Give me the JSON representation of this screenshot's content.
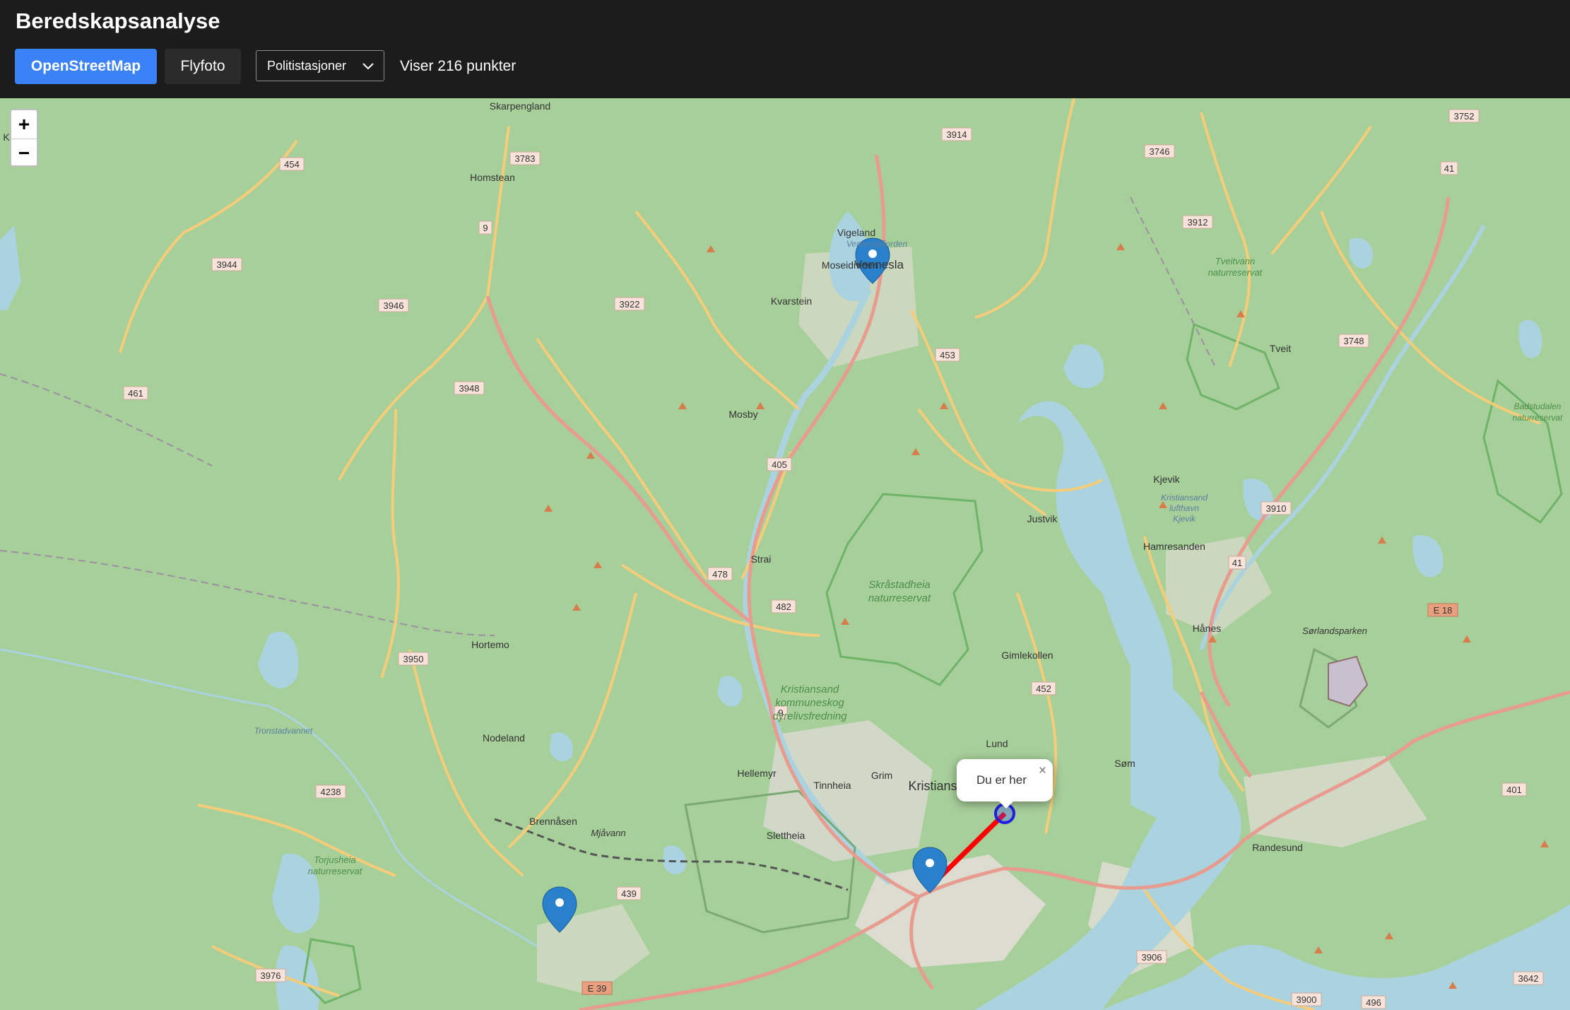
{
  "header": {
    "title": "Beredskapsanalyse",
    "btn_osm": "OpenStreetMap",
    "btn_flyfoto": "Flyfoto",
    "select_value": "Politistasjoner",
    "count_text": "Viser 216 punkter"
  },
  "zoom": {
    "in": "+",
    "out": "−"
  },
  "popup": {
    "text": "Du er her",
    "close": "×"
  },
  "colors": {
    "accent": "#3b82f6",
    "header_bg": "#1c1c1c",
    "map_land": "#aad3a0",
    "water": "#aad3df",
    "road_major": "#e89b8f",
    "road_secondary": "#f5cd7a",
    "route_line": "#ff0000",
    "marker": "#2a81cb"
  },
  "map": {
    "places": {
      "vennesla": "Vennesla",
      "moseidmoen": "Moseidmoen",
      "vigeland": "Vigeland",
      "kvarstein": "Kvarstein",
      "mosby": "Mosby",
      "strai": "Strai",
      "justvik": "Justvik",
      "kjevik": "Kjevik",
      "hamresanden": "Hamresanden",
      "tveit": "Tveit",
      "hanes": "Hånes",
      "sorlandsparken": "Sørlandsparken",
      "gimlekollen": "Gimlekollen",
      "lund": "Lund",
      "kristiansand": "Kristiansand",
      "som": "Søm",
      "randesund": "Randesund",
      "hellemyr": "Hellemyr",
      "tinnheia": "Tinnheia",
      "grim": "Grim",
      "slettheia": "Slettheia",
      "mjovann": "Mjåvann",
      "brennasen": "Brennåsen",
      "nodeland": "Nodeland",
      "hortemo": "Hortemo",
      "homstean": "Homstean",
      "kilen": "Kilen",
      "skarpengland": "Skarpengland",
      "venneslafjorden": "Venneslafjorden",
      "tronstadvannet": "Tronstadvannet"
    },
    "reserves": {
      "skrastadheia_1": "Skråstadheia",
      "skrastadheia_2": "naturreservat",
      "tveitvann_1": "Tveitvann",
      "tveitvann_2": "naturreservat",
      "badstudalen_1": "Badstudalen",
      "badstudalen_2": "naturreservat",
      "torjusheia_1": "Torjusheia",
      "torjusheia_2": "naturreservat",
      "dyrelivs_1": "Kristiansand",
      "dyrelivs_2": "kommuneskog",
      "dyrelivs_3": "dyrelivsfredning",
      "kjevik_1": "Kristiansand",
      "kjevik_2": "lufthavn",
      "kjevik_3": "Kjevik"
    },
    "road_shields": {
      "r454": "454",
      "r3783": "3783",
      "r9a": "9",
      "r3944": "3944",
      "r3946": "3946",
      "r3922": "3922",
      "r461": "461",
      "r3948": "3948",
      "r3914": "3914",
      "r3746": "3746",
      "r3912": "3912",
      "r3752": "3752",
      "r41a": "41",
      "r453": "453",
      "r3748": "3748",
      "r405": "405",
      "r478": "478",
      "r482": "482",
      "r3910": "3910",
      "r41b": "41",
      "re18": "E 18",
      "r3950": "3950",
      "r9b": "9",
      "r452": "452",
      "r4238": "4238",
      "r439": "439",
      "r3976": "3976",
      "re39": "E 39",
      "r3906": "3906",
      "r3900": "3900",
      "r496": "496",
      "r3642": "3642",
      "r401": "401"
    }
  }
}
